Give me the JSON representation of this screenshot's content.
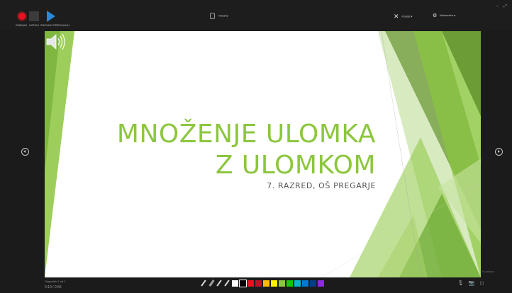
{
  "toolbar": {
    "record_label": "SNEMAJ",
    "stop_label": "USTAVI",
    "replay_label": "ZNOVNO PREDVAJAJ",
    "center_tool_label": "Vhodne",
    "right_tool_1_label": "Počisti ▾",
    "right_tool_2_label": "Nastavitve ▾",
    "minimize": "–",
    "expand": "⤢"
  },
  "slide": {
    "title_line1": "MNOŽENJE ULOMKA",
    "title_line2": "Z ULOMKOM",
    "subtitle": "7. RAZRED, OŠ PREGARJE",
    "title_color": "#8cc63f"
  },
  "status": {
    "slide_counter": "Diapozitiv 1 od 1",
    "timer": "0:19 / 0:56",
    "corner_note": "Ni zaslona"
  },
  "ink": {
    "colors": [
      "#ffffff",
      "#000000",
      "#e81123",
      "#c50f1f",
      "#ffb900",
      "#fff100",
      "#8cc63f",
      "#16c60c",
      "#00b7c3",
      "#0078d7",
      "#003f8a",
      "#8a2be2"
    ],
    "selected": 1
  },
  "icons": {
    "record": "record-icon",
    "stop": "stop-icon",
    "play": "play-icon",
    "prev": "previous-slide-icon",
    "next": "next-slide-icon",
    "speaker": "speaker-icon",
    "mic": "microphone-icon",
    "camera": "camera-icon"
  }
}
